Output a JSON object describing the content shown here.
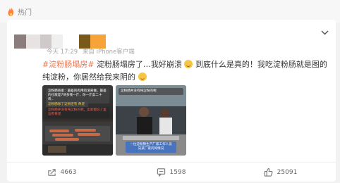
{
  "section": {
    "label": "热门",
    "icon": "flame-icon"
  },
  "post": {
    "time": "今天 17:29",
    "source": "来自 iPhone客户端",
    "hashtag": "#淀粉肠塌房#",
    "body_part1": "淀粉肠塌房了…我好崩溃",
    "body_part2": "到底什么是真的！我吃淀粉肠就是图的纯淀粉，你居然给我来阴的",
    "images": [
      {
        "name": "starch-sausage-grill",
        "caption_top": "淀粉肠商家：最差的肉用肉渣来做，最差的也就是7块多钱一斤，你一斤卖二十块...",
        "caption_mid": "淀粉肠除了淀粉还有 骨泥",
        "caption_mid_hl": "骨泥",
        "caption_bottom": "淀粉肠并没有纯淀粉的啊，卖家都说了里边有骨泥"
      },
      {
        "name": "factory-workers",
        "caption_top": "淀粉肠并没有纯淀粉的啊",
        "caption_bottom": "一位淀粉肠生产厂家工作人员",
        "caption_bottom2": "向某厂家问询情况"
      }
    ]
  },
  "actions": {
    "repost": {
      "icon": "share-icon",
      "count": "4663"
    },
    "comment": {
      "icon": "comment-icon",
      "count": "1598"
    },
    "like": {
      "icon": "thumbs-up-icon",
      "count": "25091"
    }
  },
  "colors": {
    "hashtag": "#eb7350",
    "background": "#f2f2f2",
    "card": "#ffffff"
  }
}
